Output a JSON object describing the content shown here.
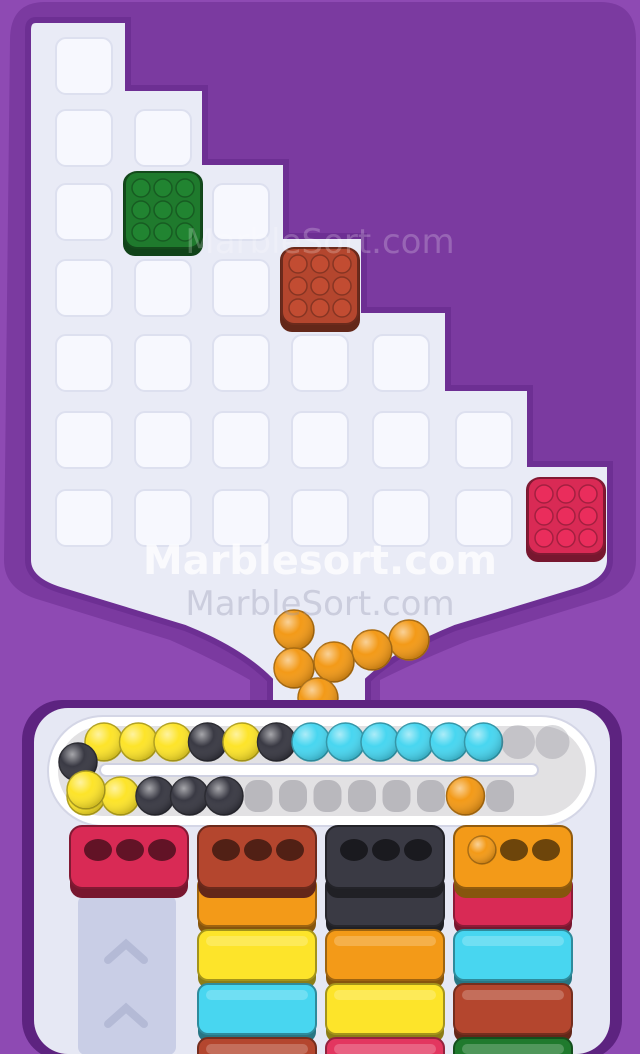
{
  "watermark": {
    "primary": "Marblesort.com",
    "secondary": "MarbleSort.com",
    "faded": "MarbleSort.com"
  },
  "colors": {
    "background": "#8e4ab3",
    "board": "#e9ebf6",
    "empty_cell": "#f7f8fe",
    "green": "#1f7a2d",
    "brown": "#b4462e",
    "pink": "#d92a55",
    "orange": "#f39a18",
    "yellow": "#fde42a",
    "cyan": "#48d6f0",
    "dark": "#3a3a44",
    "red": "#e3365f"
  },
  "board": {
    "rows": [
      [
        "empty"
      ],
      [
        "empty",
        "empty"
      ],
      [
        "empty",
        "green",
        "empty"
      ],
      [
        "empty",
        "empty",
        "empty",
        "brown"
      ],
      [
        "empty",
        "empty",
        "empty",
        "empty",
        "empty"
      ],
      [
        "empty",
        "empty",
        "empty",
        "empty",
        "empty",
        "empty"
      ],
      [
        "empty",
        "empty",
        "empty",
        "empty",
        "empty",
        "empty",
        "pink"
      ]
    ]
  },
  "funnel_marbles": [
    "orange",
    "orange",
    "orange",
    "orange",
    "orange",
    "orange",
    "orange"
  ],
  "conveyor": {
    "top_lane": [
      "yellow",
      "yellow",
      "yellow",
      "dark",
      "yellow",
      "dark",
      "cyan",
      "cyan",
      "cyan",
      "cyan",
      "cyan",
      "cyan",
      "empty",
      "empty"
    ],
    "bottom_lane": [
      "yellow",
      "yellow",
      "dark",
      "dark",
      "dark",
      "empty",
      "empty",
      "empty",
      "empty",
      "empty",
      "empty",
      "orange",
      "empty"
    ],
    "left_turn": [
      "dark",
      "yellow"
    ]
  },
  "collectors": [
    {
      "name": "collector-pink",
      "color": "pink",
      "filled": 0,
      "capacity": 3
    },
    {
      "name": "collector-brown",
      "color": "brown",
      "filled": 0,
      "capacity": 3
    },
    {
      "name": "collector-dark",
      "color": "dark",
      "filled": 0,
      "capacity": 3
    },
    {
      "name": "collector-orange",
      "color": "orange",
      "filled": 1,
      "capacity": 3
    }
  ],
  "queues": [
    [],
    [
      "orange",
      "yellow",
      "cyan",
      "brown"
    ],
    [
      "dark",
      "orange",
      "yellow",
      "red"
    ],
    [
      "pink",
      "cyan",
      "brown",
      "green"
    ]
  ]
}
